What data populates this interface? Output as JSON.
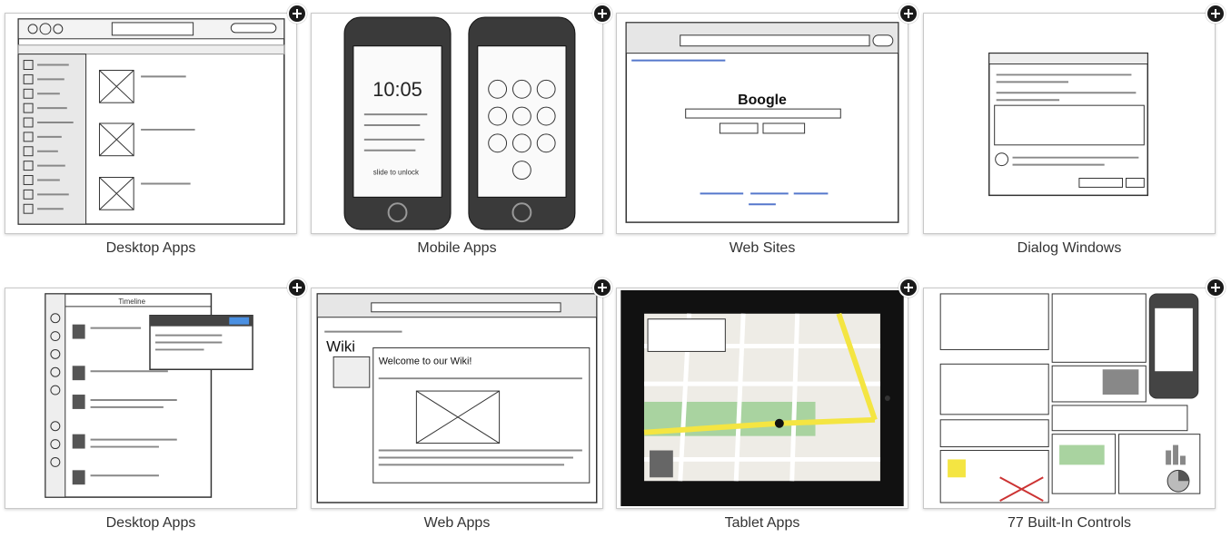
{
  "templates": [
    {
      "label": "Desktop Apps"
    },
    {
      "label": "Mobile Apps"
    },
    {
      "label": "Web Sites"
    },
    {
      "label": "Dialog Windows"
    },
    {
      "label": "Desktop Apps"
    },
    {
      "label": "Web Apps"
    },
    {
      "label": "Tablet Apps"
    },
    {
      "label": "77 Built-In Controls"
    }
  ],
  "mockups": {
    "mobile_time": "10:05",
    "mobile_unlock": "slide to unlock",
    "web_logo": "Boogle",
    "wiki_title": "Wiki",
    "wiki_welcome": "Welcome to our Wiki!",
    "twitter_title": "Timeline"
  },
  "colors": {
    "plus_bg": "#1a1a1a",
    "card_border": "#c9c9c9",
    "label": "#333333"
  }
}
